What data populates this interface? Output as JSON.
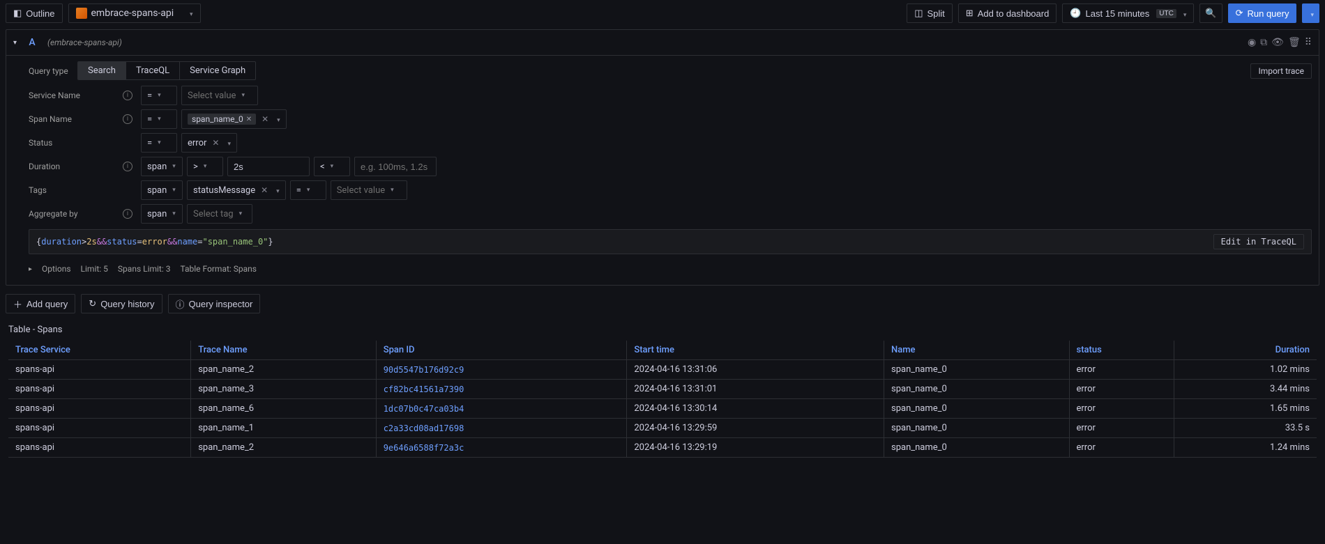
{
  "toolbar": {
    "outline_label": "Outline",
    "datasource": "embrace-spans-api",
    "split_label": "Split",
    "add_dashboard_label": "Add to dashboard",
    "time_range": "Last 15 minutes",
    "utc_badge": "UTC",
    "run_query_label": "Run query"
  },
  "query_header": {
    "letter": "A",
    "description": "(embrace-spans-api)",
    "import_trace_label": "Import trace"
  },
  "query_type": {
    "label": "Query type",
    "options": [
      "Search",
      "TraceQL",
      "Service Graph"
    ],
    "active": "Search"
  },
  "filters": {
    "service_name": {
      "label": "Service Name",
      "op": "=",
      "placeholder": "Select value"
    },
    "span_name": {
      "label": "Span Name",
      "op": "=",
      "value": "span_name_0"
    },
    "status": {
      "label": "Status",
      "op": "=",
      "value": "error"
    },
    "duration": {
      "label": "Duration",
      "scope": "span",
      "op1": ">",
      "val1": "2s",
      "op2": "<",
      "placeholder2": "e.g. 100ms, 1.2s"
    },
    "tags": {
      "label": "Tags",
      "scope": "span",
      "tag": "statusMessage",
      "op": "=",
      "placeholder": "Select value"
    },
    "aggregate": {
      "label": "Aggregate by",
      "scope": "span",
      "placeholder": "Select tag"
    }
  },
  "query_string": {
    "raw_parts": {
      "open": "{",
      "k1": "duration",
      "op1": ">",
      "v1": "2s",
      "and1": " && ",
      "k2": "status",
      "op2": "=",
      "v2": "error",
      "and2": " && ",
      "k3": "name",
      "op3": "=",
      "v3": "\"span_name_0\"",
      "close": "}"
    },
    "edit_label": "Edit in TraceQL"
  },
  "options": {
    "toggle_label": "Options",
    "limit": "Limit: 5",
    "spans_limit": "Spans Limit: 3",
    "table_format": "Table Format: Spans"
  },
  "actions": {
    "add_query": "Add query",
    "query_history": "Query history",
    "query_inspector": "Query inspector"
  },
  "table": {
    "title": "Table - Spans",
    "columns": [
      "Trace Service",
      "Trace Name",
      "Span ID",
      "Start time",
      "Name",
      "status",
      "Duration"
    ],
    "rows": [
      {
        "service": "spans-api",
        "trace": "span_name_2",
        "spanid": "90d5547b176d92c9",
        "start": "2024-04-16 13:31:06",
        "name": "span_name_0",
        "status": "error",
        "duration": "1.02 mins"
      },
      {
        "service": "spans-api",
        "trace": "span_name_3",
        "spanid": "cf82bc41561a7390",
        "start": "2024-04-16 13:31:01",
        "name": "span_name_0",
        "status": "error",
        "duration": "3.44 mins"
      },
      {
        "service": "spans-api",
        "trace": "span_name_6",
        "spanid": "1dc07b0c47ca03b4",
        "start": "2024-04-16 13:30:14",
        "name": "span_name_0",
        "status": "error",
        "duration": "1.65 mins"
      },
      {
        "service": "spans-api",
        "trace": "span_name_1",
        "spanid": "c2a33cd08ad17698",
        "start": "2024-04-16 13:29:59",
        "name": "span_name_0",
        "status": "error",
        "duration": "33.5 s"
      },
      {
        "service": "spans-api",
        "trace": "span_name_2",
        "spanid": "9e646a6588f72a3c",
        "start": "2024-04-16 13:29:19",
        "name": "span_name_0",
        "status": "error",
        "duration": "1.24 mins"
      }
    ]
  }
}
